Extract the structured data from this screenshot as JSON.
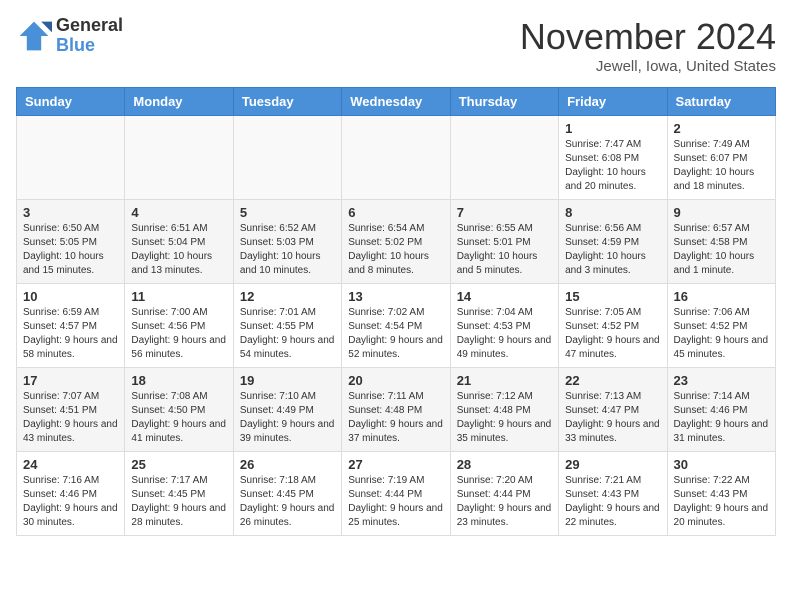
{
  "header": {
    "logo_general": "General",
    "logo_blue": "Blue",
    "month_title": "November 2024",
    "location": "Jewell, Iowa, United States"
  },
  "calendar": {
    "headers": [
      "Sunday",
      "Monday",
      "Tuesday",
      "Wednesday",
      "Thursday",
      "Friday",
      "Saturday"
    ],
    "weeks": [
      [
        {
          "day": "",
          "info": ""
        },
        {
          "day": "",
          "info": ""
        },
        {
          "day": "",
          "info": ""
        },
        {
          "day": "",
          "info": ""
        },
        {
          "day": "",
          "info": ""
        },
        {
          "day": "1",
          "info": "Sunrise: 7:47 AM\nSunset: 6:08 PM\nDaylight: 10 hours and 20 minutes."
        },
        {
          "day": "2",
          "info": "Sunrise: 7:49 AM\nSunset: 6:07 PM\nDaylight: 10 hours and 18 minutes."
        }
      ],
      [
        {
          "day": "3",
          "info": "Sunrise: 6:50 AM\nSunset: 5:05 PM\nDaylight: 10 hours and 15 minutes."
        },
        {
          "day": "4",
          "info": "Sunrise: 6:51 AM\nSunset: 5:04 PM\nDaylight: 10 hours and 13 minutes."
        },
        {
          "day": "5",
          "info": "Sunrise: 6:52 AM\nSunset: 5:03 PM\nDaylight: 10 hours and 10 minutes."
        },
        {
          "day": "6",
          "info": "Sunrise: 6:54 AM\nSunset: 5:02 PM\nDaylight: 10 hours and 8 minutes."
        },
        {
          "day": "7",
          "info": "Sunrise: 6:55 AM\nSunset: 5:01 PM\nDaylight: 10 hours and 5 minutes."
        },
        {
          "day": "8",
          "info": "Sunrise: 6:56 AM\nSunset: 4:59 PM\nDaylight: 10 hours and 3 minutes."
        },
        {
          "day": "9",
          "info": "Sunrise: 6:57 AM\nSunset: 4:58 PM\nDaylight: 10 hours and 1 minute."
        }
      ],
      [
        {
          "day": "10",
          "info": "Sunrise: 6:59 AM\nSunset: 4:57 PM\nDaylight: 9 hours and 58 minutes."
        },
        {
          "day": "11",
          "info": "Sunrise: 7:00 AM\nSunset: 4:56 PM\nDaylight: 9 hours and 56 minutes."
        },
        {
          "day": "12",
          "info": "Sunrise: 7:01 AM\nSunset: 4:55 PM\nDaylight: 9 hours and 54 minutes."
        },
        {
          "day": "13",
          "info": "Sunrise: 7:02 AM\nSunset: 4:54 PM\nDaylight: 9 hours and 52 minutes."
        },
        {
          "day": "14",
          "info": "Sunrise: 7:04 AM\nSunset: 4:53 PM\nDaylight: 9 hours and 49 minutes."
        },
        {
          "day": "15",
          "info": "Sunrise: 7:05 AM\nSunset: 4:52 PM\nDaylight: 9 hours and 47 minutes."
        },
        {
          "day": "16",
          "info": "Sunrise: 7:06 AM\nSunset: 4:52 PM\nDaylight: 9 hours and 45 minutes."
        }
      ],
      [
        {
          "day": "17",
          "info": "Sunrise: 7:07 AM\nSunset: 4:51 PM\nDaylight: 9 hours and 43 minutes."
        },
        {
          "day": "18",
          "info": "Sunrise: 7:08 AM\nSunset: 4:50 PM\nDaylight: 9 hours and 41 minutes."
        },
        {
          "day": "19",
          "info": "Sunrise: 7:10 AM\nSunset: 4:49 PM\nDaylight: 9 hours and 39 minutes."
        },
        {
          "day": "20",
          "info": "Sunrise: 7:11 AM\nSunset: 4:48 PM\nDaylight: 9 hours and 37 minutes."
        },
        {
          "day": "21",
          "info": "Sunrise: 7:12 AM\nSunset: 4:48 PM\nDaylight: 9 hours and 35 minutes."
        },
        {
          "day": "22",
          "info": "Sunrise: 7:13 AM\nSunset: 4:47 PM\nDaylight: 9 hours and 33 minutes."
        },
        {
          "day": "23",
          "info": "Sunrise: 7:14 AM\nSunset: 4:46 PM\nDaylight: 9 hours and 31 minutes."
        }
      ],
      [
        {
          "day": "24",
          "info": "Sunrise: 7:16 AM\nSunset: 4:46 PM\nDaylight: 9 hours and 30 minutes."
        },
        {
          "day": "25",
          "info": "Sunrise: 7:17 AM\nSunset: 4:45 PM\nDaylight: 9 hours and 28 minutes."
        },
        {
          "day": "26",
          "info": "Sunrise: 7:18 AM\nSunset: 4:45 PM\nDaylight: 9 hours and 26 minutes."
        },
        {
          "day": "27",
          "info": "Sunrise: 7:19 AM\nSunset: 4:44 PM\nDaylight: 9 hours and 25 minutes."
        },
        {
          "day": "28",
          "info": "Sunrise: 7:20 AM\nSunset: 4:44 PM\nDaylight: 9 hours and 23 minutes."
        },
        {
          "day": "29",
          "info": "Sunrise: 7:21 AM\nSunset: 4:43 PM\nDaylight: 9 hours and 22 minutes."
        },
        {
          "day": "30",
          "info": "Sunrise: 7:22 AM\nSunset: 4:43 PM\nDaylight: 9 hours and 20 minutes."
        }
      ]
    ]
  }
}
